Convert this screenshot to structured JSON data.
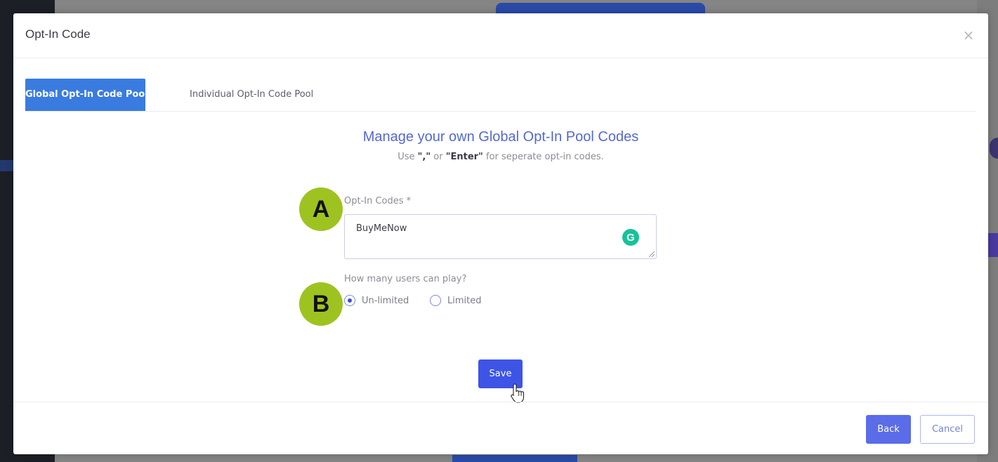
{
  "modal": {
    "title": "Opt-In Code",
    "close_glyph": "×"
  },
  "tabs": [
    {
      "label": "Global Opt-In Code Pool",
      "active": true
    },
    {
      "label": "Individual Opt-In Code Pool",
      "active": false
    }
  ],
  "content": {
    "heading": "Manage your own Global Opt-In Pool Codes",
    "subtitle": {
      "prefix": "Use ",
      "key1": "\",\"",
      "middle": " or ",
      "key2": "\"Enter\"",
      "suffix": " for seperate opt-in codes."
    }
  },
  "markers": {
    "a": "A",
    "b": "B"
  },
  "opt_in_field": {
    "label": "Opt-In Codes *",
    "value": "BuyMeNow",
    "grammarly_glyph": "G"
  },
  "users_radio": {
    "question": "How many users can play?",
    "options": [
      {
        "label": "Un-limited",
        "checked": true
      },
      {
        "label": "Limited",
        "checked": false
      }
    ]
  },
  "buttons": {
    "save": "Save",
    "back": "Back",
    "cancel": "Cancel"
  },
  "colors": {
    "primary": "#3d54e6",
    "tab_active": "#3a7be0",
    "heading": "#5469cf",
    "marker": "#9ec320",
    "grammarly": "#15c39a"
  },
  "icons": [
    "close-icon",
    "grammarly-icon",
    "resize-handle-icon",
    "hand-pointer-icon"
  ]
}
